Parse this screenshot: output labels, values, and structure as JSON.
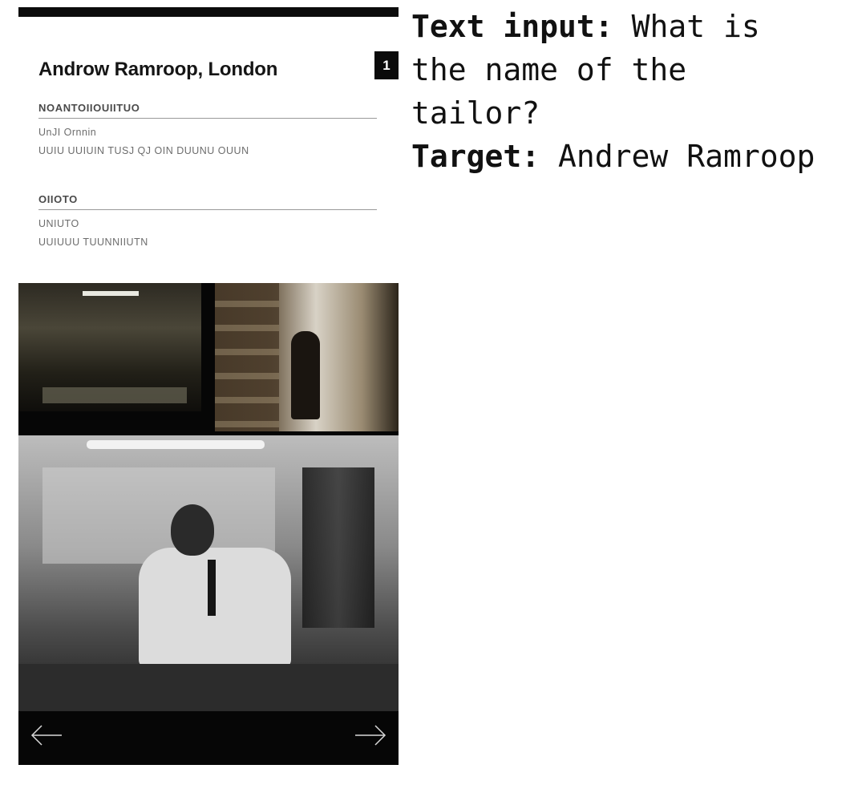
{
  "panel": {
    "title": "Androw Ramroop, London",
    "badge": "1",
    "section1": {
      "heading": "NOANTOIIOUIITUO",
      "lines": [
        "UnJI Ornnin",
        "UUIU UUIUIN TUSJ QJ OIN DUUNU OUUN"
      ]
    },
    "section2": {
      "heading": "OIIOTO",
      "lines": [
        "UNIUTO",
        "UUIUUU TUUNNIIUTN"
      ]
    },
    "photos": {
      "left_arrow": "←",
      "right_arrow": "→"
    }
  },
  "caption": {
    "text_input_label": "Text input:",
    "text_input_value_line1": "What is",
    "text_input_value_line2": "the name of the",
    "text_input_value_line3": "tailor?",
    "target_label": "Target:",
    "target_value": "Andrew Ramroop"
  }
}
